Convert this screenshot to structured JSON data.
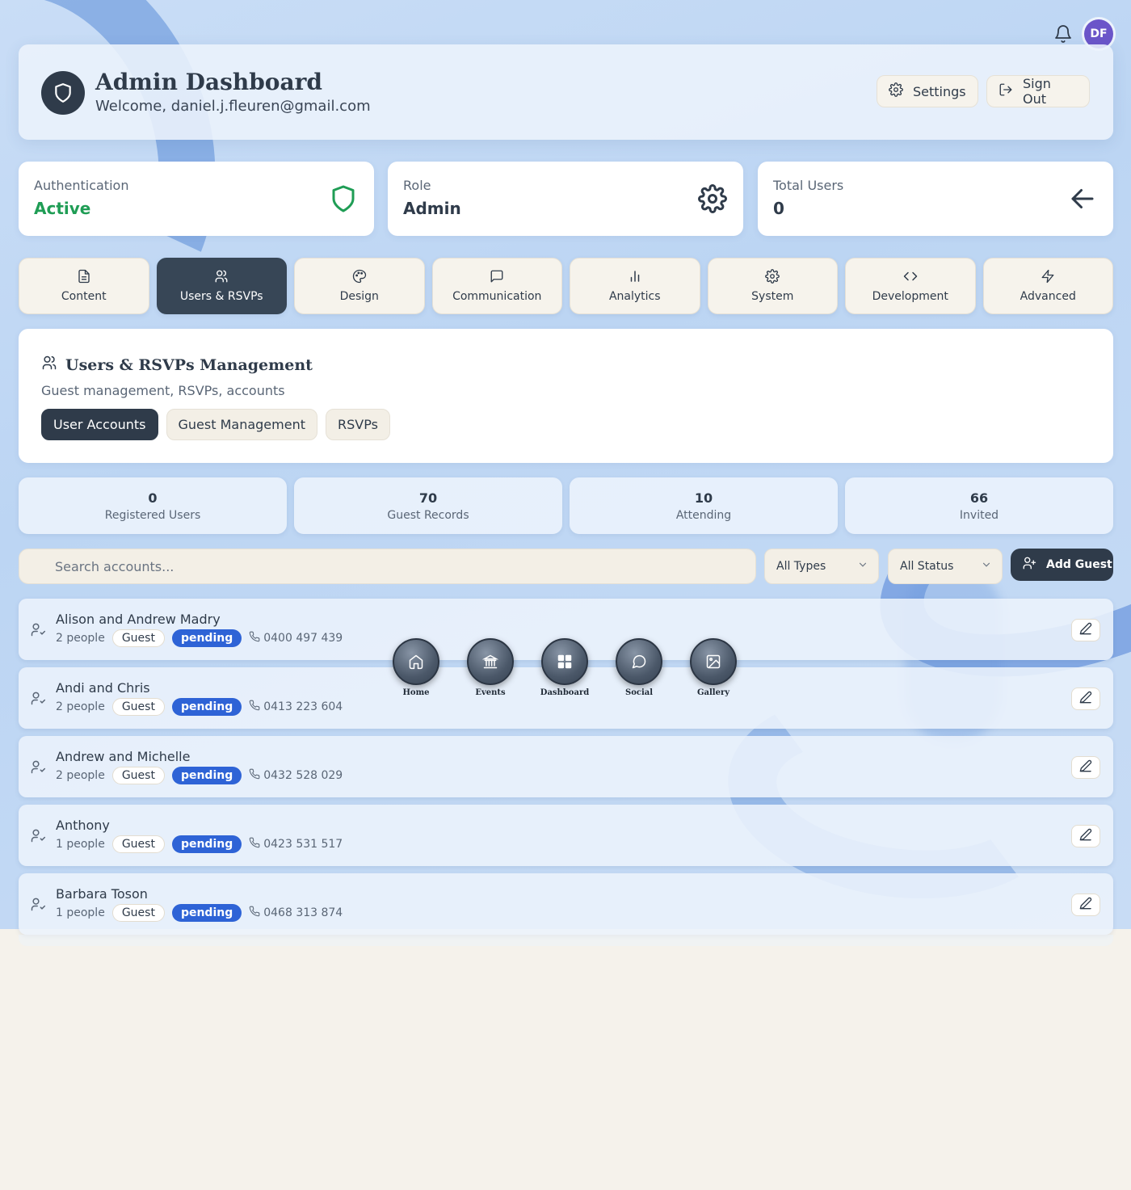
{
  "topbar": {
    "avatar_initials": "DF"
  },
  "header": {
    "title": "Admin Dashboard",
    "welcome": "Welcome, daniel.j.fleuren@gmail.com",
    "settings_label": "Settings",
    "signout_label": "Sign Out"
  },
  "stats": [
    {
      "label": "Authentication",
      "value": "Active",
      "icon": "shield-icon"
    },
    {
      "label": "Role",
      "value": "Admin",
      "icon": "gear-icon"
    },
    {
      "label": "Total Users",
      "value": "0",
      "icon": "arrow-left-icon"
    }
  ],
  "tabs": [
    {
      "label": "Content",
      "icon": "document-icon"
    },
    {
      "label": "Users & RSVPs",
      "icon": "users-icon",
      "active": true
    },
    {
      "label": "Design",
      "icon": "palette-icon"
    },
    {
      "label": "Communication",
      "icon": "message-icon"
    },
    {
      "label": "Analytics",
      "icon": "bar-chart-icon"
    },
    {
      "label": "System",
      "icon": "gear-icon"
    },
    {
      "label": "Development",
      "icon": "code-icon"
    },
    {
      "label": "Advanced",
      "icon": "lightning-icon"
    }
  ],
  "management": {
    "title": "Users & RSVPs Management",
    "subtitle": "Guest management, RSVPs, accounts",
    "subtabs": [
      "User Accounts",
      "Guest Management",
      "RSVPs"
    ]
  },
  "counts": [
    {
      "value": "0",
      "label": "Registered Users"
    },
    {
      "value": "70",
      "label": "Guest Records"
    },
    {
      "value": "10",
      "label": "Attending"
    },
    {
      "value": "66",
      "label": "Invited"
    }
  ],
  "filters": {
    "search_placeholder": "Search accounts...",
    "type_select": "All Types",
    "status_select": "All Status",
    "add_guest_label": "Add Guest"
  },
  "guests": [
    {
      "name": "Alison and Andrew Madry",
      "people": "2 people",
      "type": "Guest",
      "status": "pending",
      "phone": "0400 497 439"
    },
    {
      "name": "Andi and Chris",
      "people": "2 people",
      "type": "Guest",
      "status": "pending",
      "phone": "0413 223 604"
    },
    {
      "name": "Andrew and Michelle",
      "people": "2 people",
      "type": "Guest",
      "status": "pending",
      "phone": "0432 528 029"
    },
    {
      "name": "Anthony",
      "people": "1 people",
      "type": "Guest",
      "status": "pending",
      "phone": "0423 531 517"
    },
    {
      "name": "Barbara Toson",
      "people": "1 people",
      "type": "Guest",
      "status": "pending",
      "phone": "0468 313 874"
    }
  ],
  "dock": [
    {
      "label": "Home",
      "icon": "home-icon"
    },
    {
      "label": "Events",
      "icon": "building-icon"
    },
    {
      "label": "Dashboard",
      "icon": "grid-icon"
    },
    {
      "label": "Social",
      "icon": "chat-bubble-icon"
    },
    {
      "label": "Gallery",
      "icon": "image-icon"
    }
  ],
  "colors": {
    "primary": "#2f3b4a",
    "active_tab": "#374656",
    "pending": "#2e63d6",
    "success": "#1f9d55",
    "avatar": "#6b55c9"
  }
}
